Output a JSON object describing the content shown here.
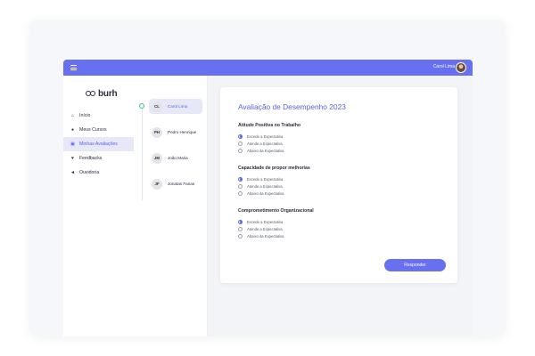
{
  "header": {
    "user_name": "Carol Lima"
  },
  "brand": {
    "name": "burh"
  },
  "sidebar": {
    "items": [
      {
        "label": "Início",
        "icon": "home-icon"
      },
      {
        "label": "Meus Cursos",
        "icon": "play-circle-icon"
      },
      {
        "label": "Minhas Avaliações",
        "icon": "clipboard-icon",
        "active": true
      },
      {
        "label": "Feedbacks",
        "icon": "heart-icon"
      },
      {
        "label": "Ouvidoria",
        "icon": "megaphone-icon"
      }
    ]
  },
  "people": [
    {
      "initials": "CL",
      "name": "Carol Lima",
      "active": true
    },
    {
      "initials": "PH",
      "name": "Pedro Henrique"
    },
    {
      "initials": "JM",
      "name": "João Maria"
    },
    {
      "initials": "JF",
      "name": "Jonatas Farias"
    }
  ],
  "evaluation": {
    "title": "Avaliação de Desempenho 2023",
    "questions": [
      {
        "title": "Atitude Positiva no Trabalho",
        "options": [
          "Excede a Expectativa",
          "Atende a Expectativa",
          "Abaixo da Expectativa"
        ],
        "selected": 0
      },
      {
        "title": "Capacidade de propor melhorias",
        "options": [
          "Excede a Expectativa",
          "Atende a Expectativa",
          "Abaixo da Expectativa"
        ],
        "selected": 0
      },
      {
        "title": "Comprometimento Organizacional",
        "options": [
          "Excede a Expectativa",
          "Atende a Expectativa",
          "Abaixo da Expectativa"
        ],
        "selected": 0
      }
    ],
    "submit_label": "Responder"
  },
  "colors": {
    "accent": "#6770f0",
    "active_bg": "#e6e8f8",
    "timeline_dot": "#3fbf7f"
  }
}
